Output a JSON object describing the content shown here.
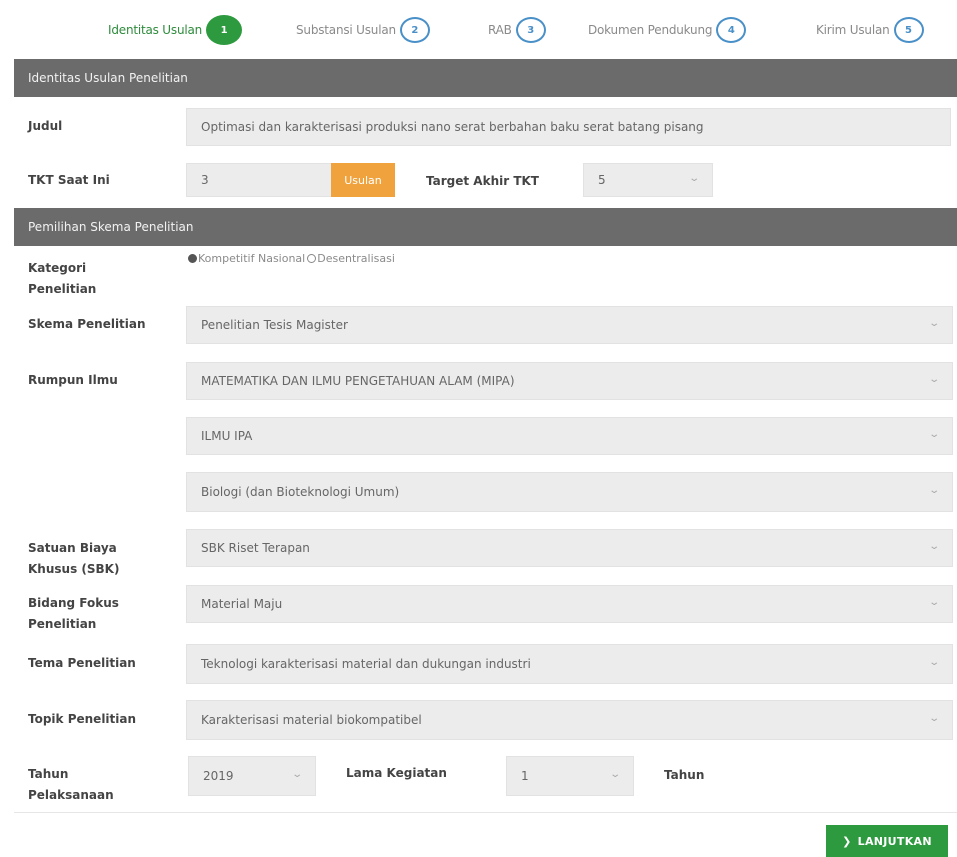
{
  "steps": [
    {
      "label": "Identitas Usulan",
      "num": "1",
      "active": true
    },
    {
      "label": "Substansi Usulan",
      "num": "2",
      "active": false
    },
    {
      "label": "RAB",
      "num": "3",
      "active": false
    },
    {
      "label": "Dokumen Pendukung",
      "num": "4",
      "active": false
    },
    {
      "label": "Kirim Usulan",
      "num": "5",
      "active": false
    }
  ],
  "section1": {
    "title": "Identitas Usulan Penelitian"
  },
  "judul": {
    "label": "Judul",
    "value": "Optimasi dan karakterisasi produksi nano serat berbahan baku serat batang pisang"
  },
  "tkt": {
    "label": "TKT Saat Ini",
    "value": "3",
    "button": "Usulan",
    "target_label": "Target Akhir TKT",
    "target_value": "5"
  },
  "section2": {
    "title": "Pemilihan Skema Penelitian"
  },
  "kategori": {
    "label": "Kategori Penelitian",
    "options": [
      {
        "label": "Kompetitif Nasional",
        "selected": true
      },
      {
        "label": "Desentralisasi",
        "selected": false
      }
    ]
  },
  "skema": {
    "label": "Skema Penelitian",
    "value": "Penelitian Tesis Magister"
  },
  "rumpun": {
    "label": "Rumpun Ilmu",
    "level1": "MATEMATIKA DAN ILMU PENGETAHUAN ALAM (MIPA)",
    "level2": "ILMU IPA",
    "level3": "Biologi (dan Bioteknologi Umum)"
  },
  "sbk": {
    "label": "Satuan Biaya Khusus (SBK)",
    "value": "SBK Riset Terapan"
  },
  "bidang": {
    "label": "Bidang Fokus Penelitian",
    "value": "Material Maju"
  },
  "tema": {
    "label": "Tema Penelitian",
    "value": "Teknologi karakterisasi material dan dukungan industri"
  },
  "topik": {
    "label": "Topik Penelitian",
    "value": "Karakterisasi material biokompatibel"
  },
  "tahun": {
    "label": "Tahun Pelaksanaan",
    "value": "2019",
    "lama_label": "Lama Kegiatan",
    "lama_value": "1",
    "unit": "Tahun"
  },
  "footer": {
    "next_label": "LANJUTKAN"
  },
  "colors": {
    "accent_green": "#2e9a3f",
    "step_blue": "#4a90c8",
    "orange": "#f0a23c",
    "header_gray": "#6b6b6b"
  }
}
